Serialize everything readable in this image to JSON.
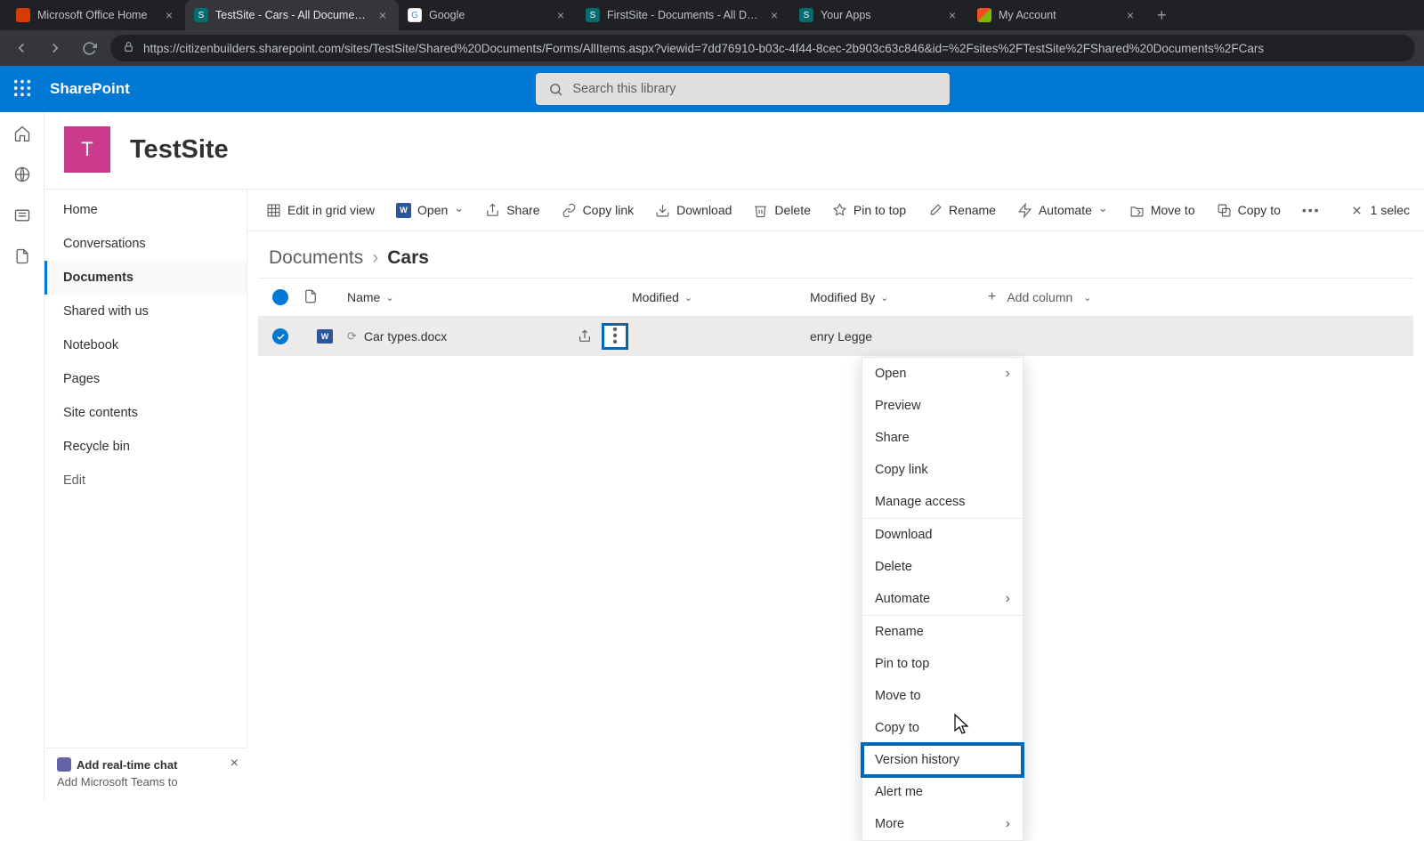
{
  "browser": {
    "tabs": [
      {
        "title": "Microsoft Office Home",
        "fav_bg": "#d83b01",
        "fav_txt": ""
      },
      {
        "title": "TestSite - Cars - All Documents",
        "fav_bg": "#036c70",
        "fav_txt": "S",
        "active": true
      },
      {
        "title": "Google",
        "fav_bg": "#ffffff",
        "fav_txt": "G"
      },
      {
        "title": "FirstSite - Documents - All Docum",
        "fav_bg": "#036c70",
        "fav_txt": "S"
      },
      {
        "title": "Your Apps",
        "fav_bg": "#036c70",
        "fav_txt": "S"
      },
      {
        "title": "My Account",
        "fav_bg": "#00a4ef",
        "fav_txt": ""
      }
    ],
    "url": "https://citizenbuilders.sharepoint.com/sites/TestSite/Shared%20Documents/Forms/AllItems.aspx?viewid=7dd76910-b03c-4f44-8cec-2b903c63c846&id=%2Fsites%2FTestSite%2FShared%20Documents%2FCars"
  },
  "suite": {
    "brand": "SharePoint",
    "search_placeholder": "Search this library"
  },
  "site": {
    "logo_letter": "T",
    "title": "TestSite"
  },
  "left_nav": {
    "items": [
      {
        "label": "Home"
      },
      {
        "label": "Conversations"
      },
      {
        "label": "Documents",
        "active": true
      },
      {
        "label": "Shared with us"
      },
      {
        "label": "Notebook"
      },
      {
        "label": "Pages"
      },
      {
        "label": "Site contents"
      },
      {
        "label": "Recycle bin"
      }
    ],
    "edit": "Edit"
  },
  "cmdbar": {
    "edit_grid": "Edit in grid view",
    "open": "Open",
    "share": "Share",
    "copy_link": "Copy link",
    "download": "Download",
    "delete": "Delete",
    "pin": "Pin to top",
    "rename": "Rename",
    "automate": "Automate",
    "move": "Move to",
    "copy": "Copy to",
    "selection": "1 selec"
  },
  "breadcrumb": {
    "root": "Documents",
    "current": "Cars"
  },
  "columns": {
    "name": "Name",
    "modified": "Modified",
    "modified_by": "Modified By",
    "add": "Add column"
  },
  "row": {
    "filename": "Car types.docx",
    "modified_by": "enry Legge"
  },
  "context_menu": {
    "open": "Open",
    "preview": "Preview",
    "share": "Share",
    "copy_link": "Copy link",
    "manage_access": "Manage access",
    "download": "Download",
    "delete": "Delete",
    "automate": "Automate",
    "rename": "Rename",
    "pin": "Pin to top",
    "move": "Move to",
    "copy": "Copy to",
    "version_history": "Version history",
    "alert": "Alert me",
    "more": "More"
  },
  "promo": {
    "title": "Add real-time chat",
    "body": "Add Microsoft Teams to"
  }
}
